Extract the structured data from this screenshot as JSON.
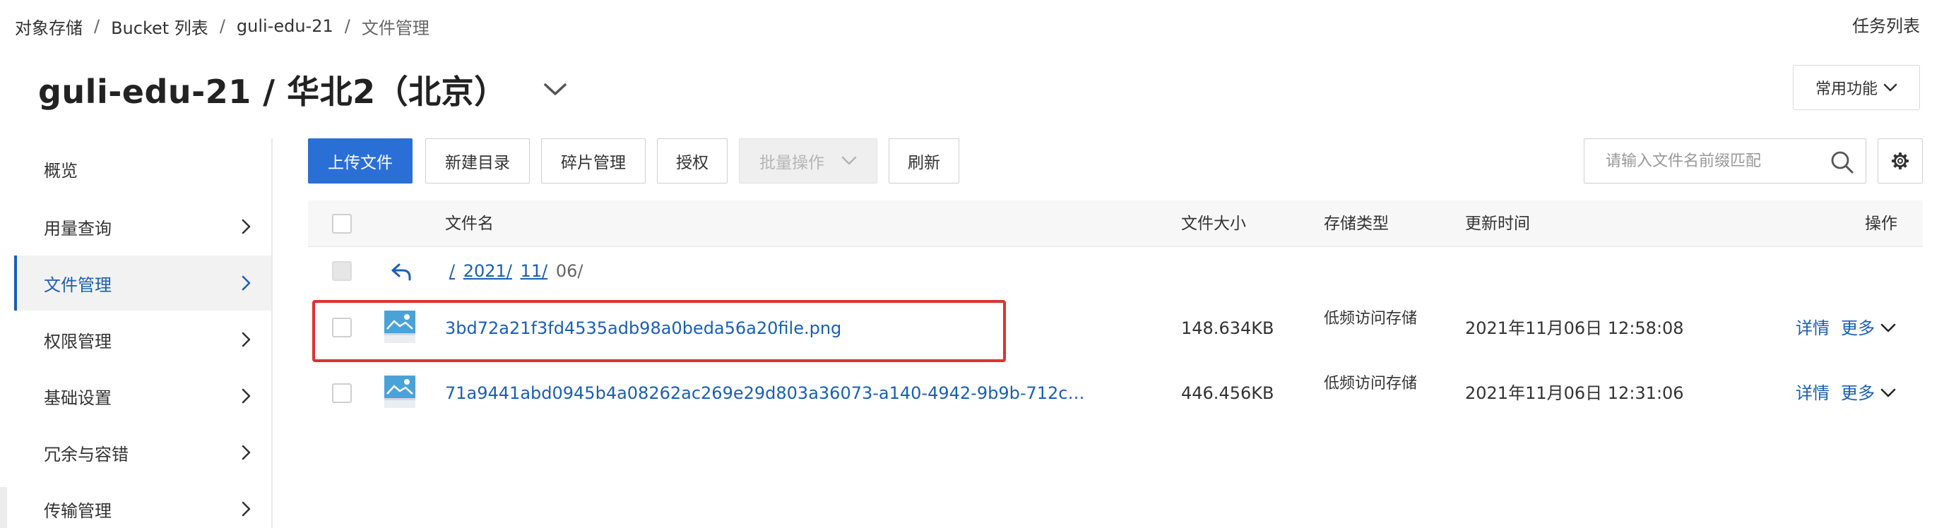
{
  "breadcrumb": [
    "对象存储",
    "Bucket 列表",
    "guli-edu-21",
    "文件管理"
  ],
  "breadcrumb_sep": "/",
  "header": {
    "task_list": "任务列表",
    "title": "guli-edu-21 / 华北2（北京）",
    "common_functions": "常用功能"
  },
  "sidebar": {
    "items": [
      {
        "label": "概览",
        "active": false,
        "has_arrow": false
      },
      {
        "label": "用量查询",
        "active": false,
        "has_arrow": true
      },
      {
        "label": "文件管理",
        "active": true,
        "has_arrow": true
      },
      {
        "label": "权限管理",
        "active": false,
        "has_arrow": true
      },
      {
        "label": "基础设置",
        "active": false,
        "has_arrow": true
      },
      {
        "label": "冗余与容错",
        "active": false,
        "has_arrow": true
      },
      {
        "label": "传输管理",
        "active": false,
        "has_arrow": true
      }
    ]
  },
  "toolbar": {
    "upload": "上传文件",
    "new_dir": "新建目录",
    "fragments": "碎片管理",
    "authorize": "授权",
    "batch": "批量操作",
    "refresh": "刷新",
    "search_placeholder": "请输入文件名前缀匹配"
  },
  "table": {
    "columns": {
      "name": "文件名",
      "size": "文件大小",
      "storage": "存储类型",
      "updated": "更新时间",
      "action": "操作"
    },
    "path": {
      "root": "/",
      "segments": [
        "2021/",
        "11/"
      ],
      "current": "06/"
    },
    "rows": [
      {
        "name": "3bd72a21f3fd4535adb98a0beda56a20file.png",
        "size": "148.634KB",
        "storage": "低频访问存储",
        "updated": "2021年11月06日 12:58:08",
        "detail": "详情",
        "more": "更多",
        "highlighted": true
      },
      {
        "name": "71a9441abd0945b4a08262ac269e29d803a36073-a140-4942-9b9b-712c…",
        "size": "446.456KB",
        "storage": "低频访问存储",
        "updated": "2021年11月06日 12:31:06",
        "detail": "详情",
        "more": "更多",
        "highlighted": false
      }
    ]
  },
  "colors": {
    "accent": "#1a5fb4",
    "primary_button": "#2a6fd6",
    "highlight": "#e03131"
  },
  "icons": [
    "chevron-down-icon",
    "chevron-right-icon",
    "search-icon",
    "gear-icon",
    "back-arrow-icon",
    "image-file-icon"
  ]
}
